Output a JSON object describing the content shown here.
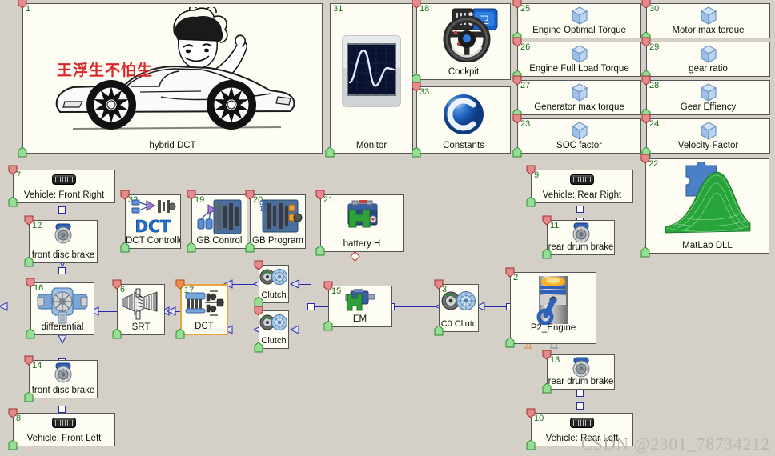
{
  "app": {
    "background_color": "#d4d0c8",
    "block_fill": "#fdfdf3",
    "block_border": "#555555",
    "wire_color": "#2a2ab0",
    "electrical_wire_color": "#c02020",
    "number_color": "#1e6b1e",
    "selected_border": "#e8a33d"
  },
  "watermark": "CSDN @2301_78734212",
  "blocks": [
    {
      "id": "1",
      "label": "hybrid DCT",
      "icon": "sports-car-cartoon-icon",
      "caption": "王浮生不怕生"
    },
    {
      "id": "31",
      "label": "Monitor",
      "icon": "oscilloscope-monitor-icon"
    },
    {
      "id": "18",
      "label": "Cockpit",
      "icon": "steering-wheel-icon"
    },
    {
      "id": "33",
      "label": "Constants",
      "icon": "blue-c-sphere-icon"
    },
    {
      "id": "25",
      "label": "Engine Optimal Torque",
      "icon": "blue-cube-icon"
    },
    {
      "id": "26",
      "label": "Engine Full Load Torque",
      "icon": "blue-cube-icon"
    },
    {
      "id": "27",
      "label": "Generator max torque",
      "icon": "blue-cube-icon"
    },
    {
      "id": "23",
      "label": "SOC factor",
      "icon": "blue-cube-icon"
    },
    {
      "id": "30",
      "label": "Motor max torque",
      "icon": "blue-cube-icon"
    },
    {
      "id": "29",
      "label": "gear ratio",
      "icon": "blue-cube-icon"
    },
    {
      "id": "28",
      "label": "Gear Effiency",
      "icon": "blue-cube-icon"
    },
    {
      "id": "24",
      "label": "Velocity Factor",
      "icon": "blue-cube-icon"
    },
    {
      "id": "7",
      "label": "Vehicle: Front Right",
      "icon": "tire-icon"
    },
    {
      "id": "12",
      "label": "front disc brake",
      "icon": "disc-brake-icon"
    },
    {
      "id": "32",
      "label": "DCT Controlle",
      "icon": "dct-controller-icon"
    },
    {
      "id": "19",
      "label": "GB Control",
      "icon": "gearbox-control-icon"
    },
    {
      "id": "20",
      "label": "GB Program",
      "icon": "gearbox-program-icon"
    },
    {
      "id": "21",
      "label": "battery H",
      "icon": "battery-icon"
    },
    {
      "id": "9",
      "label": "Vehicle: Rear Right",
      "icon": "tire-icon"
    },
    {
      "id": "11",
      "label": "rear drum brake",
      "icon": "drum-brake-icon"
    },
    {
      "id": "22",
      "label": "MatLab DLL",
      "icon": "matlab-surface-icon"
    },
    {
      "id": "16",
      "label": "differential",
      "icon": "differential-icon"
    },
    {
      "id": "6",
      "label": "SRT",
      "icon": "bevel-gears-icon"
    },
    {
      "id": "17",
      "label": "DCT",
      "icon": "dual-clutch-transmission-icon",
      "selected": true
    },
    {
      "id": "4",
      "label": "Clutch",
      "icon": "clutch-icon"
    },
    {
      "id": "5",
      "label": "Clutch",
      "icon": "clutch-icon"
    },
    {
      "id": "15",
      "label": "EM",
      "icon": "electric-motor-icon"
    },
    {
      "id": "3",
      "label": "C0 Cllutc",
      "icon": "clutch-icon"
    },
    {
      "id": "2",
      "label": "P2_Engine",
      "icon": "piston-engine-icon"
    },
    {
      "id": "14",
      "label": "front disc brake",
      "icon": "disc-brake-icon"
    },
    {
      "id": "8",
      "label": "Vehicle: Front Left",
      "icon": "tire-icon"
    },
    {
      "id": "13",
      "label": "rear drum brake",
      "icon": "drum-brake-icon"
    },
    {
      "id": "10",
      "label": "Vehicle: Rear Left",
      "icon": "tire-icon"
    }
  ]
}
